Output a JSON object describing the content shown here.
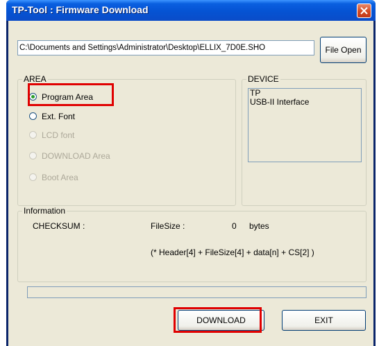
{
  "window": {
    "title": "TP-Tool : Firmware Download"
  },
  "file": {
    "path": "C:\\Documents and Settings\\Administrator\\Desktop\\ELLIX_7D0E.SHO",
    "open_label": "File Open"
  },
  "area": {
    "legend": "AREA",
    "options": [
      {
        "label": "Program Area",
        "selected": true,
        "enabled": true
      },
      {
        "label": "Ext. Font",
        "selected": false,
        "enabled": true
      },
      {
        "label": "LCD font",
        "selected": false,
        "enabled": false
      },
      {
        "label": "DOWNLOAD Area",
        "selected": false,
        "enabled": false
      },
      {
        "label": "Boot Area",
        "selected": false,
        "enabled": false
      }
    ]
  },
  "device": {
    "legend": "DEVICE",
    "lines": [
      "TP",
      "USB-II Interface"
    ]
  },
  "information": {
    "legend": "Information",
    "checksum_label": "CHECKSUM :",
    "filesize_label": "FileSize :",
    "filesize_value": "0",
    "filesize_unit": "bytes",
    "formula": "(* Header[4] + FileSize[4] + data[n] + CS[2] )"
  },
  "progress": {
    "value": 0
  },
  "buttons": {
    "download": "DOWNLOAD",
    "exit": "EXIT"
  },
  "colors": {
    "highlight": "#e00000",
    "titlebar": "#0553d3",
    "dialog_bg": "#ece9d8"
  }
}
